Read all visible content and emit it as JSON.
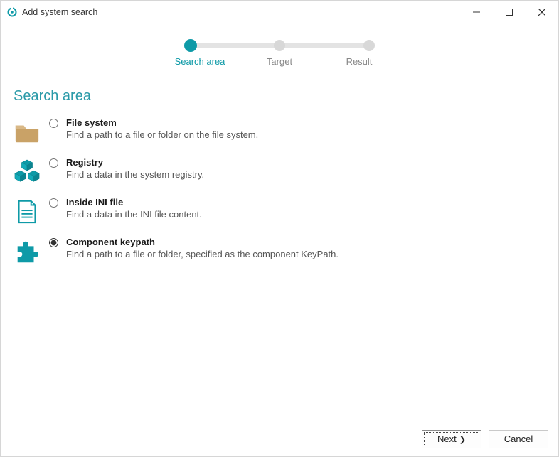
{
  "window": {
    "title": "Add system search"
  },
  "stepper": {
    "steps": [
      {
        "label": "Search area",
        "active": true
      },
      {
        "label": "Target",
        "active": false
      },
      {
        "label": "Result",
        "active": false
      }
    ]
  },
  "heading": "Search area",
  "options": [
    {
      "id": "file-system",
      "title": "File system",
      "desc": "Find a path to a file or folder on the file system.",
      "selected": false,
      "icon": "folder-icon",
      "icon_color": "#c9a267"
    },
    {
      "id": "registry",
      "title": "Registry",
      "desc": "Find a data in the system registry.",
      "selected": false,
      "icon": "cubes-icon",
      "icon_color": "#0e9aa7"
    },
    {
      "id": "ini",
      "title": "Inside INI file",
      "desc": "Find a data in the INI file content.",
      "selected": false,
      "icon": "ini-file-icon",
      "icon_color": "#0e9aa7"
    },
    {
      "id": "component-keypath",
      "title": "Component keypath",
      "desc": "Find a path to a file or folder, specified as the component KeyPath.",
      "selected": true,
      "icon": "puzzle-icon",
      "icon_color": "#0e9aa7"
    }
  ],
  "footer": {
    "next_label": "Next",
    "cancel_label": "Cancel"
  },
  "colors": {
    "accent": "#0e9aa7"
  }
}
